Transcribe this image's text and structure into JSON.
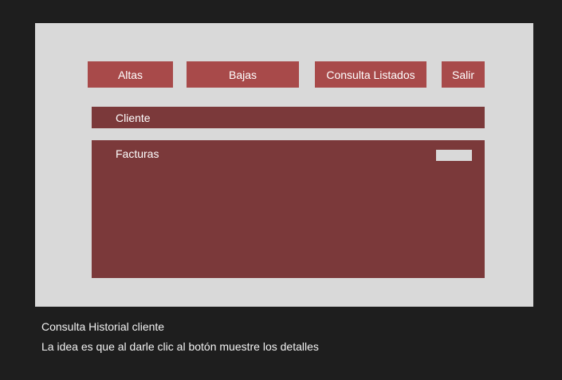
{
  "nav": {
    "altas_label": "Altas",
    "bajas_label": "Bajas",
    "consulta_label": "Consulta Listados",
    "salir_label": "Salir"
  },
  "cliente": {
    "label": "Cliente"
  },
  "facturas": {
    "label": "Facturas"
  },
  "caption": {
    "title": "Consulta Historial cliente",
    "note": "La idea es que al darle clic al botón muestre los detalles"
  },
  "colors": {
    "page_background": "#1e1e1e",
    "frame_background": "#d9d9d9",
    "nav_button": "#a84a4a",
    "panel": "#7b393a",
    "text_light": "#ffffff"
  }
}
